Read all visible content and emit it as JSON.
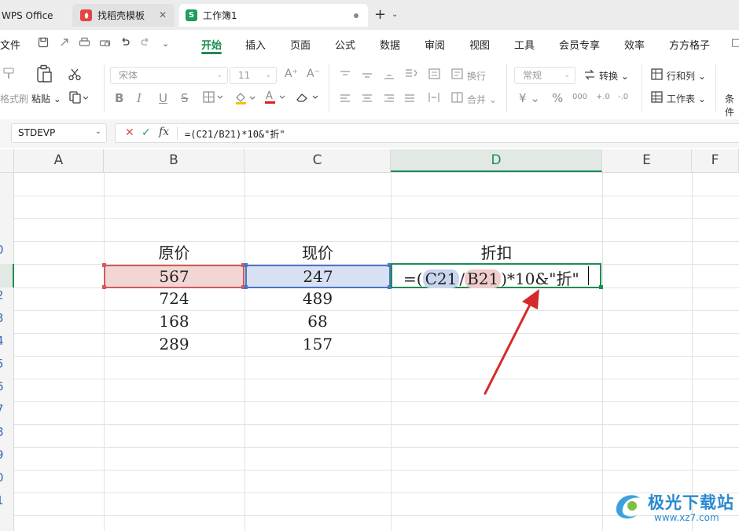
{
  "titlebar": {
    "tabs": [
      {
        "label": "WPS Office"
      },
      {
        "label": "找稻壳模板",
        "close": "✕"
      },
      {
        "label": "工作簿1",
        "badge": "S"
      }
    ],
    "new_tab": "+",
    "tab_menu": "⌄"
  },
  "menubar": {
    "file": "文件",
    "items": [
      "开始",
      "插入",
      "页面",
      "公式",
      "数据",
      "审阅",
      "视图",
      "工具",
      "会员专享",
      "效率",
      "方方格子"
    ],
    "active": "开始",
    "icons": [
      "save-icon",
      "export-icon",
      "print-icon",
      "print-preview-icon",
      "undo-icon",
      "redo-icon",
      "more-icon"
    ]
  },
  "ribbon": {
    "format_painter": "格式刷",
    "paste": "粘贴",
    "font_name": "宋体",
    "font_size": "11",
    "wrap": "换行",
    "merge": "合并",
    "number_format": "常规",
    "convert": "转换",
    "row_col": "行和列",
    "worksheet": "工作表",
    "cond_prefix": "条件",
    "font_buttons": [
      "B",
      "I",
      "U",
      "S"
    ],
    "currency": "¥",
    "percent": "%",
    "thousands": "000",
    "dec_inc": "+.0",
    "dec_dec": "-.0"
  },
  "formula_bar": {
    "name_box": "STDEVP",
    "cancel": "✕",
    "confirm": "✓",
    "fx": "fx",
    "formula": "=(C21/B21)*10&\"折\""
  },
  "grid": {
    "columns": [
      "A",
      "B",
      "C",
      "D",
      "E",
      "F"
    ],
    "active_column": "D",
    "row_numbers": [
      "",
      "",
      "",
      "0",
      "",
      "2",
      "3",
      "4",
      "5",
      "6",
      "7",
      "8",
      "9",
      "0",
      "1"
    ],
    "headers": {
      "B": "原价",
      "C": "现价",
      "D": "折扣"
    },
    "rows": [
      {
        "B": "567",
        "C": "247"
      },
      {
        "B": "724",
        "C": "489"
      },
      {
        "B": "168",
        "C": "68"
      },
      {
        "B": "289",
        "C": "157"
      }
    ],
    "editing_cell": {
      "prefix": "=(",
      "ref1": "C21",
      "slash": "/",
      "ref2": "B21",
      "suffix": ")*10&\"折\""
    },
    "highlight_colors": {
      "C21": "#4e74c5",
      "B21": "#d15b5b",
      "active": "#1f8c53",
      "arrow": "#d42a2a"
    }
  },
  "watermark": {
    "title": "极光下载站",
    "url": "www.xz7.com"
  }
}
